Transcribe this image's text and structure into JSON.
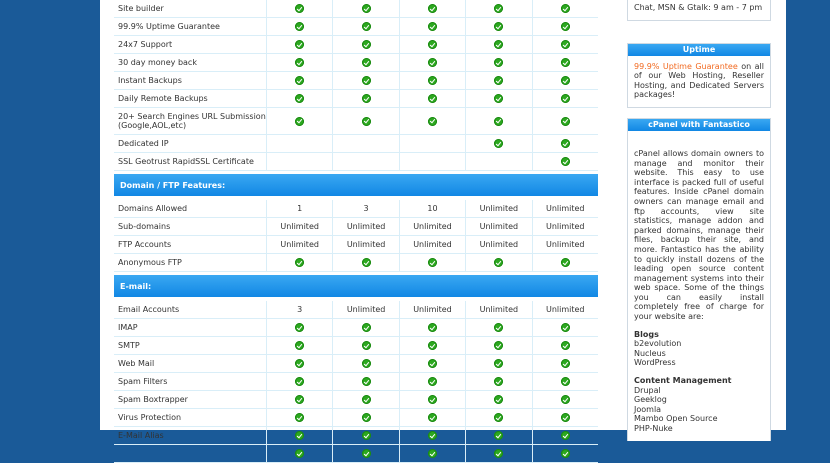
{
  "plans_count": 5,
  "rows_top": [
    {
      "label": "Site builder",
      "cells": [
        "check",
        "check",
        "check",
        "check",
        "check"
      ]
    },
    {
      "label": "99.9% Uptime Guarantee",
      "cells": [
        "check",
        "check",
        "check",
        "check",
        "check"
      ]
    },
    {
      "label": "24x7 Support",
      "cells": [
        "check",
        "check",
        "check",
        "check",
        "check"
      ]
    },
    {
      "label": "30 day money back",
      "cells": [
        "check",
        "check",
        "check",
        "check",
        "check"
      ]
    },
    {
      "label": "Instant Backups",
      "cells": [
        "check",
        "check",
        "check",
        "check",
        "check"
      ]
    },
    {
      "label": "Daily Remote Backups",
      "cells": [
        "check",
        "check",
        "check",
        "check",
        "check"
      ]
    },
    {
      "label": "20+ Search Engines URL Submission (Google,AOL,etc)",
      "cells": [
        "check",
        "check",
        "check",
        "check",
        "check"
      ],
      "tall": true
    },
    {
      "label": "Dedicated IP",
      "cells": [
        "",
        "",
        "",
        "check",
        "check"
      ]
    },
    {
      "label": "SSL Geotrust RapidSSL Certificate",
      "cells": [
        "",
        "",
        "",
        "",
        "check"
      ]
    }
  ],
  "section_domain": "Domain / FTP Features:",
  "rows_domain": [
    {
      "label": "Domains Allowed",
      "cells": [
        "1",
        "3",
        "10",
        "Unlimited",
        "Unlimited"
      ]
    },
    {
      "label": "Sub-domains",
      "cells": [
        "Unlimited",
        "Unlimited",
        "Unlimited",
        "Unlimited",
        "Unlimited"
      ]
    },
    {
      "label": "FTP Accounts",
      "cells": [
        "Unlimited",
        "Unlimited",
        "Unlimited",
        "Unlimited",
        "Unlimited"
      ]
    },
    {
      "label": "Anonymous FTP",
      "cells": [
        "check",
        "check",
        "check",
        "check",
        "check"
      ]
    }
  ],
  "section_email": "E-mail:",
  "rows_email": [
    {
      "label": "Email Accounts",
      "cells": [
        "3",
        "Unlimited",
        "Unlimited",
        "Unlimited",
        "Unlimited"
      ]
    },
    {
      "label": "IMAP",
      "cells": [
        "check",
        "check",
        "check",
        "check",
        "check"
      ]
    },
    {
      "label": "SMTP",
      "cells": [
        "check",
        "check",
        "check",
        "check",
        "check"
      ]
    },
    {
      "label": "Web Mail",
      "cells": [
        "check",
        "check",
        "check",
        "check",
        "check"
      ]
    },
    {
      "label": "Spam Filters",
      "cells": [
        "check",
        "check",
        "check",
        "check",
        "check"
      ]
    },
    {
      "label": "Spam Boxtrapper",
      "cells": [
        "check",
        "check",
        "check",
        "check",
        "check"
      ]
    },
    {
      "label": "Virus Protection",
      "cells": [
        "check",
        "check",
        "check",
        "check",
        "check"
      ]
    },
    {
      "label": "E-Mail Alias",
      "cells": [
        "check",
        "check",
        "check",
        "check",
        "check"
      ]
    },
    {
      "label": "",
      "cells": [
        "check",
        "check",
        "check",
        "check",
        "check"
      ]
    }
  ],
  "sidebar": {
    "contact_tail": "Chat, MSN & Gtalk: 9 am - 7 pm",
    "uptime": {
      "title": "Uptime",
      "highlight": "99.9% Uptime Guarantee",
      "text": " on all of our Web Hosting, Reseller Hosting, and Dedicated Servers packages!"
    },
    "cpanel": {
      "title": "cPanel with Fantastico",
      "text": "cPanel allows domain owners to manage and monitor their website. This easy to use interface is packed full of useful features. Inside cPanel domain owners can manage email and ftp accounts, view site statistics, manage addon and parked domains, manage their files, backup their site, and more. Fantastico has the ability to quickly install dozens of the leading open source content management systems into their web space. Some of the things you can easily install completely free of charge for your website are:",
      "groups": [
        {
          "title": "Blogs",
          "items": [
            "b2evolution",
            "Nucleus",
            "WordPress"
          ]
        },
        {
          "title": "Content Management",
          "items": [
            "Drupal",
            "Geeklog",
            "Joomla",
            "Mambo Open Source",
            "PHP-Nuke"
          ]
        }
      ]
    }
  },
  "colors": {
    "page_bg": "#1a5a98",
    "header_blue": "#1187e4",
    "check_green": "#2ca81f",
    "highlight": "#f26a21"
  }
}
